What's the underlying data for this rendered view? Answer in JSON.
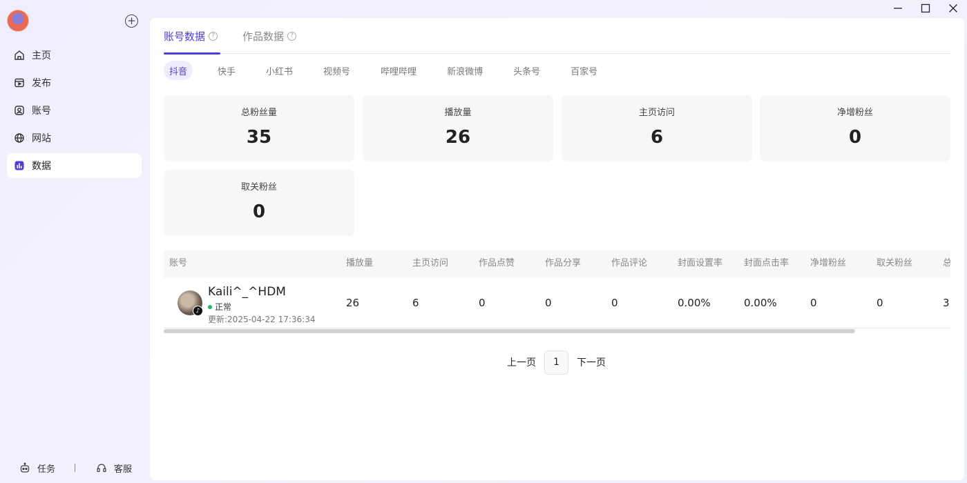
{
  "sidebar": {
    "items": [
      {
        "label": "主页",
        "icon": "home-icon"
      },
      {
        "label": "发布",
        "icon": "publish-icon"
      },
      {
        "label": "账号",
        "icon": "account-icon"
      },
      {
        "label": "网站",
        "icon": "globe-icon"
      },
      {
        "label": "数据",
        "icon": "chart-icon",
        "active": true
      }
    ],
    "bottom": {
      "tasks_label": "任务",
      "support_label": "客服"
    }
  },
  "tabs": [
    {
      "label": "账号数据",
      "active": true
    },
    {
      "label": "作品数据",
      "active": false
    }
  ],
  "platforms": [
    {
      "label": "抖音",
      "active": true
    },
    {
      "label": "快手"
    },
    {
      "label": "小红书"
    },
    {
      "label": "视频号"
    },
    {
      "label": "哔哩哔哩"
    },
    {
      "label": "新浪微博"
    },
    {
      "label": "头条号"
    },
    {
      "label": "百家号"
    }
  ],
  "stats": [
    {
      "label": "总粉丝量",
      "value": "35"
    },
    {
      "label": "播放量",
      "value": "26"
    },
    {
      "label": "主页访问",
      "value": "6"
    },
    {
      "label": "净增粉丝",
      "value": "0"
    },
    {
      "label": "取关粉丝",
      "value": "0"
    }
  ],
  "table": {
    "columns": [
      "账号",
      "播放量",
      "主页访问",
      "作品点赞",
      "作品分享",
      "作品评论",
      "封面设置率",
      "封面点击率",
      "净增粉丝",
      "取关粉丝",
      "总"
    ],
    "rows": [
      {
        "name": "Kaili^_^HDM",
        "status": "正常",
        "updated": "更新:2025-04-22 17:36:34",
        "cells": [
          "26",
          "6",
          "0",
          "0",
          "0",
          "0.00%",
          "0.00%",
          "0",
          "0",
          "3"
        ]
      }
    ]
  },
  "pager": {
    "prev": "上一页",
    "page": "1",
    "next": "下一页"
  },
  "colors": {
    "accent": "#4b3fd6",
    "status_ok": "#22b36b"
  }
}
